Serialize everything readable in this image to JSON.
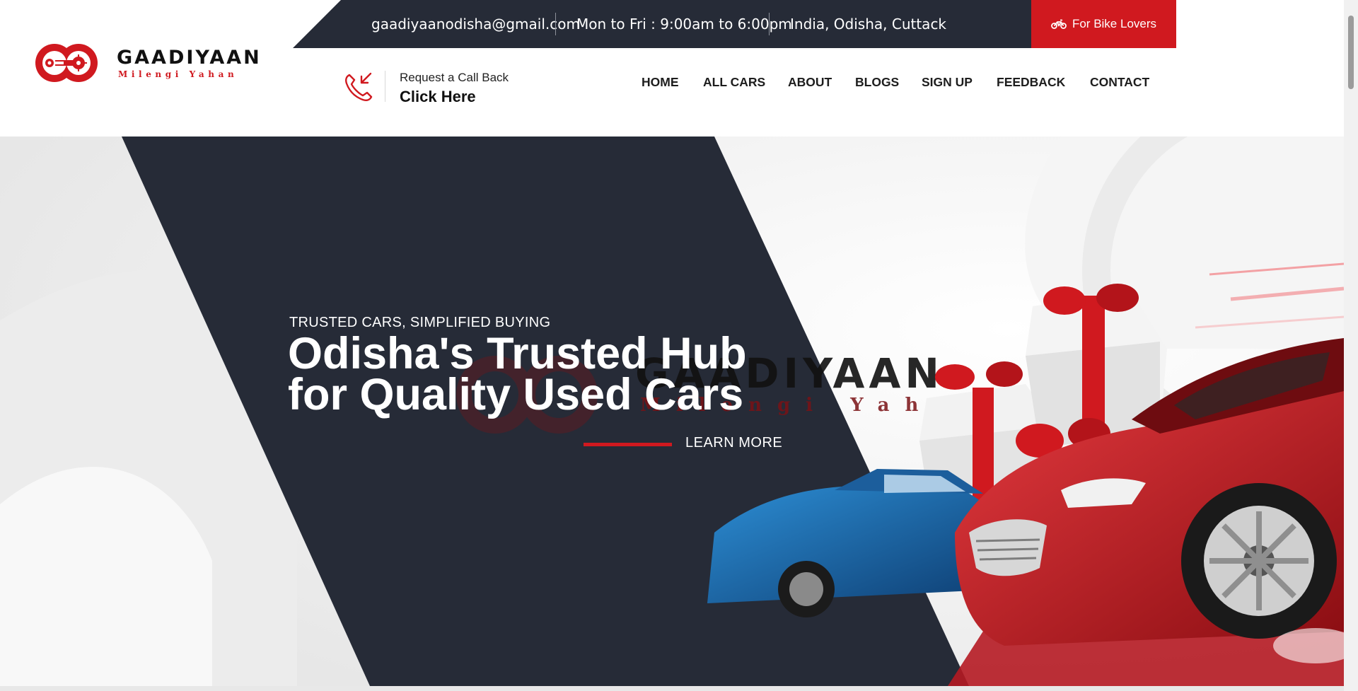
{
  "brand": {
    "name": "GAADIYAAN",
    "tagline": "Milengi Yahan",
    "accent_color": "#d0191f",
    "dark_color": "#262b37"
  },
  "topbar": {
    "email": "gaadiyaanodisha@gmail.com",
    "hours": "Mon to Fri : 9:00am to 6:00pm",
    "location": "India, Odisha, Cuttack",
    "bike_button": "For Bike Lovers",
    "bike_icon": "motorcycle-icon"
  },
  "callback": {
    "icon": "phone-incoming-icon",
    "small_text": "Request a Call Back",
    "big_text": "Click Here"
  },
  "nav": {
    "items": [
      "HOME",
      "ALL CARS",
      "ABOUT",
      "BLOGS",
      "SIGN UP",
      "FEEDBACK",
      "CONTACT"
    ]
  },
  "hero": {
    "subtitle": "TRUSTED CARS, SIMPLIFIED BUYING",
    "title_line1": "Odisha's Trusted Hub",
    "title_line2": "for Quality Used Cars",
    "cta": "LEARN MORE",
    "watermark_name": "GAADIYAAN",
    "watermark_tag": "Milengi Yahan"
  }
}
